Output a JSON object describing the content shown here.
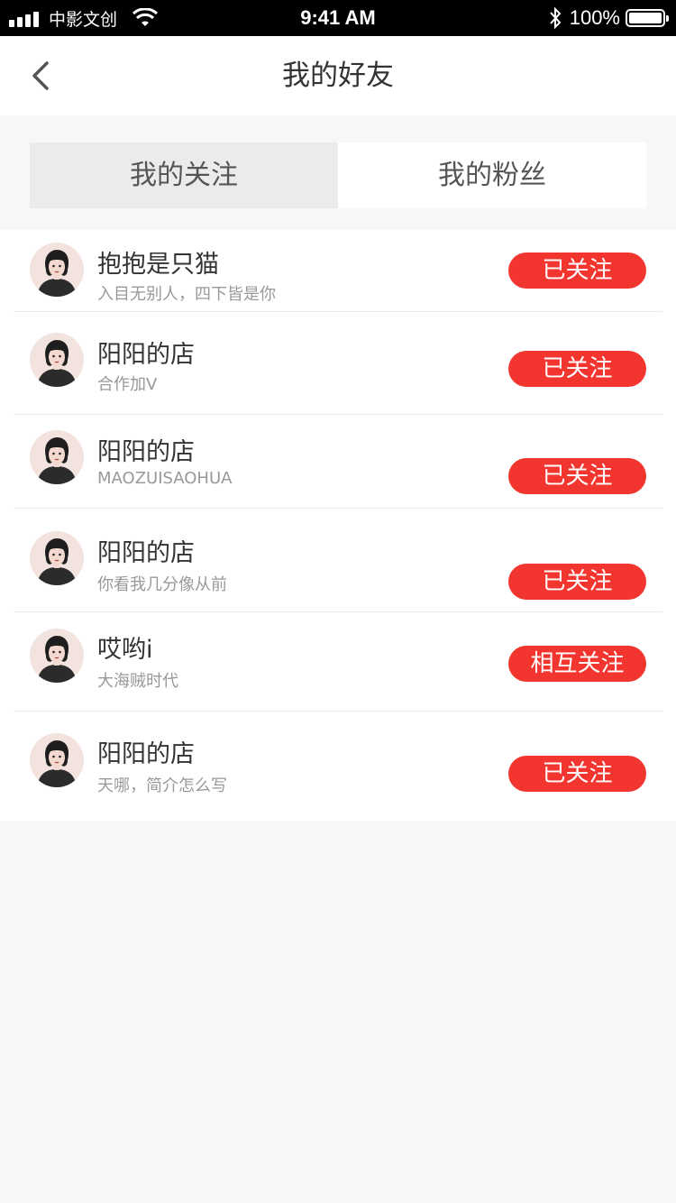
{
  "status_bar": {
    "carrier": "中影文创",
    "time": "9:41 AM",
    "battery_percent": "100%",
    "battery_level": 1.0
  },
  "header": {
    "title": "我的好友",
    "back_icon": "chevron-left-icon"
  },
  "tabs": [
    {
      "label": "我的关注",
      "active": true
    },
    {
      "label": "我的粉丝",
      "active": false
    }
  ],
  "friends": [
    {
      "name": "抱抱是只猫",
      "bio": "入目无别人，四下皆是你",
      "button": "已关注"
    },
    {
      "name": "阳阳的店",
      "bio": "合作加V",
      "button": "已关注"
    },
    {
      "name": "阳阳的店",
      "bio": "MAOZUISAOHUA",
      "button": "已关注"
    },
    {
      "name": "阳阳的店",
      "bio": "你看我几分像从前",
      "button": "已关注"
    },
    {
      "name": "哎哟i",
      "bio": "大海贼时代",
      "button": "相互关注"
    },
    {
      "name": "阳阳的店",
      "bio": "天哪，简介怎么写",
      "button": "已关注"
    }
  ],
  "colors": {
    "accent": "#f2362f",
    "background": "#f7f7f7"
  }
}
